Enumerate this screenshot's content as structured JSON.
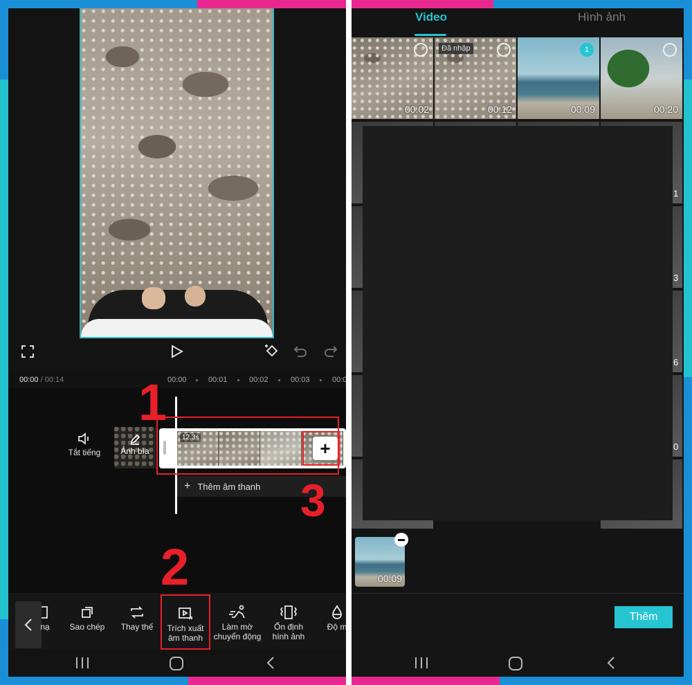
{
  "left": {
    "timeline": {
      "current_time": "00:00",
      "separator": " / ",
      "total_time": "00:14",
      "ticks": [
        "00:00",
        "00:01",
        "00:02",
        "00:03",
        "00:0"
      ],
      "clip_duration": "12.3s",
      "mute_label": "Tắt tiếng",
      "cover_label": "Ảnh bìa",
      "add_audio_label": "Thêm âm thanh"
    },
    "callouts": [
      "1",
      "2",
      "3"
    ],
    "toolbar": {
      "items": [
        {
          "label": "nạ",
          "icon": "crop-icon"
        },
        {
          "label": "Sao chép",
          "icon": "copy-icon"
        },
        {
          "label": "Thay thế",
          "icon": "replace-icon"
        },
        {
          "label": "Trích xuất\nâm thanh",
          "icon": "extract-audio-icon"
        },
        {
          "label": "Làm mờ\nchuyển động",
          "icon": "motion-blur-icon"
        },
        {
          "label": "Ổn định\nhình ảnh",
          "icon": "stabilize-icon"
        },
        {
          "label": "Độ m",
          "icon": "opacity-icon"
        }
      ]
    }
  },
  "right": {
    "tabs": {
      "video": "Video",
      "image": "Hình ảnh"
    },
    "grid_top_row": [
      {
        "duration": "00:02",
        "style": "sand",
        "state": "circle"
      },
      {
        "duration": "00:12",
        "style": "sand",
        "state": "circle",
        "badge": "Đã nhập"
      },
      {
        "duration": "00:09",
        "style": "sea",
        "state": "number",
        "number": "1"
      },
      {
        "duration": "00:20",
        "style": "tree",
        "state": "circle"
      }
    ],
    "edge_numbers": [
      "1",
      "3",
      "6",
      "0"
    ],
    "selected": {
      "duration": "00:09"
    },
    "add_button_label": "Thêm"
  },
  "accent_color": "#27c4d2",
  "callout_color": "#e8202a"
}
